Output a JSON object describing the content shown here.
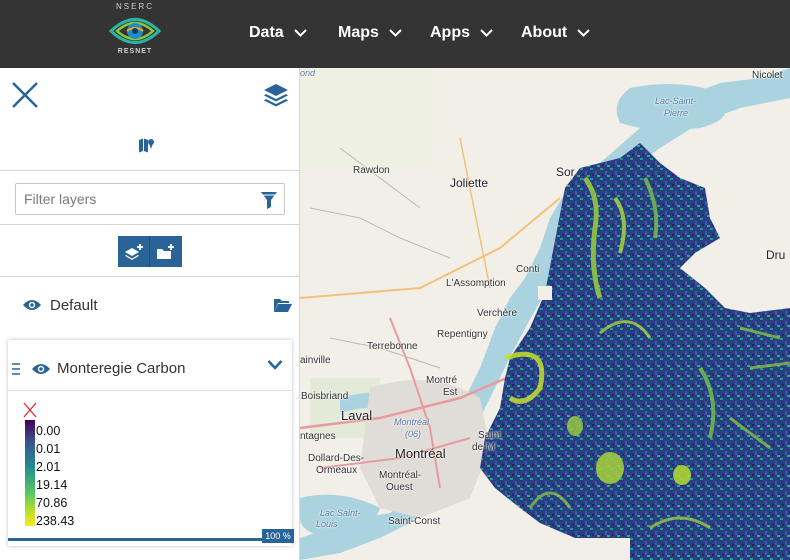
{
  "brand": {
    "top": "NSERC",
    "bottom": "RESNET"
  },
  "nav": [
    {
      "label": "Data"
    },
    {
      "label": "Maps"
    },
    {
      "label": "Apps"
    },
    {
      "label": "About"
    }
  ],
  "panel": {
    "filter_placeholder": "Filter layers",
    "group": {
      "label": "Default"
    },
    "layer": {
      "label": "Monteregie Carbon",
      "legend": [
        "0.00",
        "0.01",
        "2.01",
        "19.14",
        "70.86",
        "238.43"
      ],
      "progress": "100 %"
    }
  },
  "map": {
    "labels": {
      "nicolet": "Nicolet",
      "lac_saint_pierre_1": "Lac-Saint-",
      "lac_saint_pierre_2": "Pierre",
      "rawdon": "Rawdon",
      "joliette": "Joliette",
      "sorel": "Sor",
      "dru": "Dru",
      "conti": "Conti",
      "lassomption": "L'Assomption",
      "verchere": "Verchère",
      "repentigny": "Repentigny",
      "terrebonne": "Terrebonne",
      "mont_1": "Montré",
      "mont_2": "Est",
      "ainville": "ainville",
      "boisbriand": "Boisbriand",
      "laval": "Laval",
      "montreal_06_1": "Montréal",
      "montreal_06_2": "(06)",
      "saint_1": "Saint",
      "saint_2": "de-M",
      "ntagnes": "ntagnes",
      "dollard_1": "Dollard-Des-",
      "dollard_2": "Ormeaux",
      "montreal": "Montréal",
      "montreal_ouest_1": "Montréal-",
      "montreal_ouest_2": "Ouest",
      "lac_saint_louis_1": "Lac Saint-",
      "lac_saint_louis_2": "Louis",
      "saint_const": "Saint-Const",
      "ond": "ond"
    }
  }
}
